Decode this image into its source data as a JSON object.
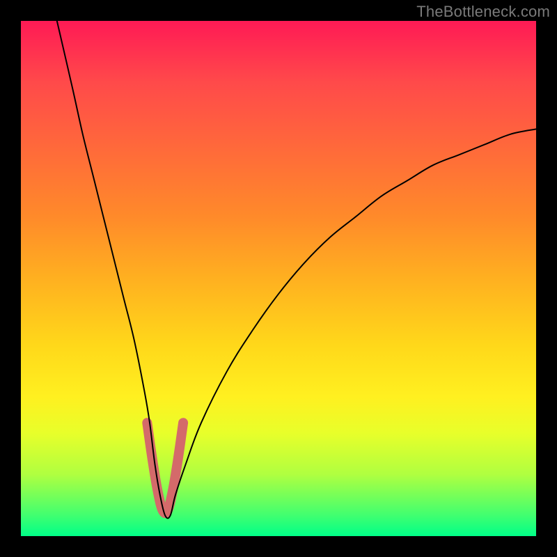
{
  "watermark": "TheBottleneck.com",
  "colors": {
    "background_frame": "#000000",
    "curve": "#000000",
    "accent_curve": "#d46a6a",
    "gradient_top": "#ff1a55",
    "gradient_bottom": "#00ff88"
  },
  "chart_data": {
    "type": "line",
    "title": "",
    "xlabel": "",
    "ylabel": "",
    "xlim": [
      0,
      100
    ],
    "ylim": [
      0,
      100
    ],
    "grid": false,
    "series": [
      {
        "name": "bottleneck-curve",
        "x": [
          7,
          10,
          12,
          14,
          16,
          18,
          20,
          22,
          24,
          25,
          26,
          27,
          28,
          29,
          30,
          32,
          35,
          40,
          45,
          50,
          55,
          60,
          65,
          70,
          75,
          80,
          85,
          90,
          95,
          100
        ],
        "y": [
          100,
          87,
          78,
          70,
          62,
          54,
          46,
          38,
          28,
          22,
          14,
          8,
          4,
          4,
          8,
          14,
          22,
          32,
          40,
          47,
          53,
          58,
          62,
          66,
          69,
          72,
          74,
          76,
          78,
          79
        ]
      },
      {
        "name": "highlight-segment",
        "x": [
          24.5,
          25.5,
          26.5,
          27.5,
          28.5,
          29.5,
          30.5,
          31.5
        ],
        "y": [
          22,
          15,
          9,
          5,
          5,
          9,
          15,
          22
        ]
      }
    ]
  }
}
